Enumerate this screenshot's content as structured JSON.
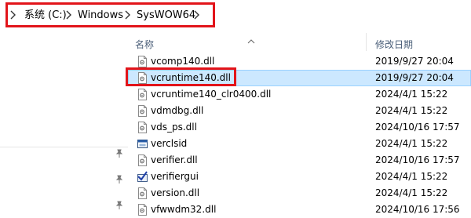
{
  "breadcrumb": {
    "items": [
      {
        "label": "系统 (C:)"
      },
      {
        "label": "Windows"
      },
      {
        "label": "SysWOW64"
      }
    ]
  },
  "columns": {
    "name": "名称",
    "date_modified": "修改日期"
  },
  "files": [
    {
      "name": "vcomp140.dll",
      "date": "2019/9/27 20:04",
      "icon": "dll-file-icon"
    },
    {
      "name": "vcruntime140.dll",
      "date": "2019/9/27 20:04",
      "icon": "dll-file-icon",
      "selected": true
    },
    {
      "name": "vcruntime140_clr0400.dll",
      "date": "2024/4/1 15:22",
      "icon": "dll-file-icon"
    },
    {
      "name": "vdmdbg.dll",
      "date": "2024/4/1 15:22",
      "icon": "dll-file-icon"
    },
    {
      "name": "vds_ps.dll",
      "date": "2024/10/16 17:57",
      "icon": "dll-file-icon"
    },
    {
      "name": "verclsid",
      "date": "2024/4/1 15:22",
      "icon": "application-icon"
    },
    {
      "name": "verifier.dll",
      "date": "2024/10/16 17:57",
      "icon": "dll-file-icon"
    },
    {
      "name": "verifiergui",
      "date": "2024/4/1 15:22",
      "icon": "checkmark-app-icon"
    },
    {
      "name": "version.dll",
      "date": "2024/4/1 15:22",
      "icon": "dll-file-icon"
    },
    {
      "name": "vfwwdm32.dll",
      "date": "2024/10/16 17:56",
      "icon": "dll-file-icon"
    }
  ],
  "colors": {
    "annotation_red": "#e2141a",
    "selection_fill": "#cce8ff",
    "header_text": "#4c607a"
  }
}
